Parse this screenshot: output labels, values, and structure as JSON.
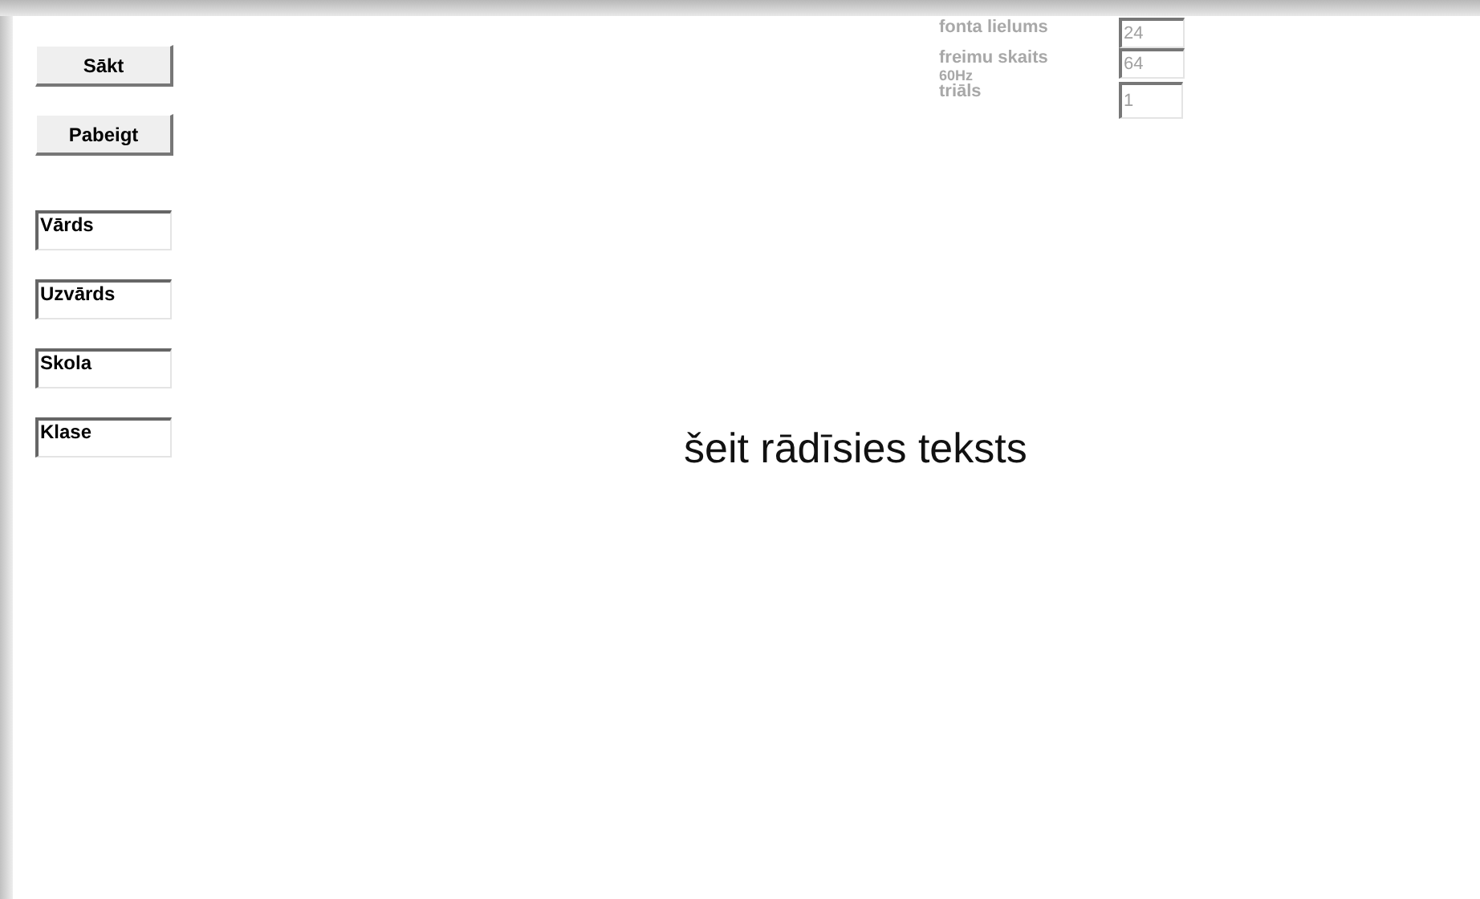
{
  "buttons": [
    "Sākt",
    "Pabeigt"
  ],
  "fields": [
    {
      "value": "Vārds"
    },
    {
      "value": "Uzvārds"
    },
    {
      "value": "Skola"
    },
    {
      "value": "Klase"
    }
  ],
  "settings": [
    {
      "label": "fonta lielums",
      "value": "24"
    },
    {
      "label": "freimu skaits",
      "value": "64",
      "note": "60Hz"
    },
    {
      "label": "triāls",
      "value": "1"
    }
  ],
  "display_text": "šeit rādīsies teksts"
}
